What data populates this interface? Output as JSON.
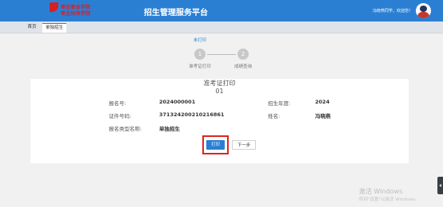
{
  "header": {
    "logo_line1": "枣庄职业学院",
    "logo_line2": "枣庄技师学院",
    "platform_title": "招生管理服务平台",
    "welcome": "冯晓燕同学，欢迎您！"
  },
  "tabs": [
    {
      "label": "首页"
    },
    {
      "label": "单独招生"
    }
  ],
  "steps": {
    "status": "未打印",
    "items": [
      {
        "num": "1",
        "label": "准考证打印"
      },
      {
        "num": "2",
        "label": "成绩查询"
      }
    ]
  },
  "card": {
    "title": "准考证打印",
    "subtitle": "01",
    "fields": {
      "signup_no": {
        "label": "报名号:",
        "value": "2024000001"
      },
      "year": {
        "label": "招生年度:",
        "value": "2024"
      },
      "id_no": {
        "label": "证件号码:",
        "value": "371324200210216861"
      },
      "name": {
        "label": "姓名:",
        "value": "冯晓燕"
      },
      "type": {
        "label": "报名类型名称:",
        "value": "单独招生"
      }
    }
  },
  "buttons": {
    "print": "打印",
    "next": "下一步"
  },
  "colors": {
    "header_bg": "#2b7fd3",
    "primary": "#2b7fd3",
    "highlight": "#e3241b",
    "logo": "#d71f26"
  },
  "watermark": {
    "line1": "激活 Windows",
    "line2": "转到\"设置\"以激活 Windows。"
  }
}
